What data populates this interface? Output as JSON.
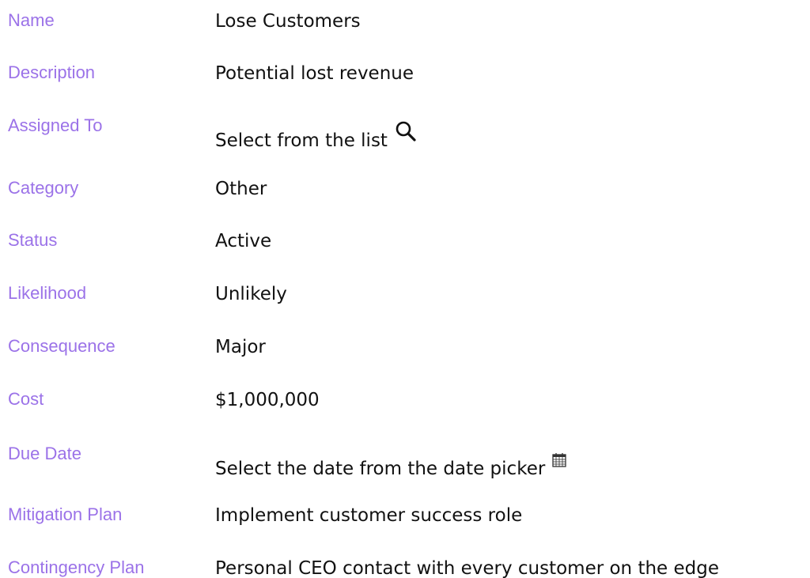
{
  "fields": [
    {
      "label": "Name",
      "value": "Lose Customers"
    },
    {
      "label": "Description",
      "value": "Potential lost revenue"
    },
    {
      "label": "Assigned To",
      "value": "Select from the list",
      "icon": "search-icon"
    },
    {
      "label": "Category",
      "value": "Other"
    },
    {
      "label": "Status",
      "value": "Active"
    },
    {
      "label": "Likelihood",
      "value": "Unlikely"
    },
    {
      "label": "Consequence",
      "value": "Major"
    },
    {
      "label": "Cost",
      "value": "$1,000,000"
    },
    {
      "label": "Due Date",
      "value": "Select the date from the date picker",
      "icon": "calendar-icon"
    },
    {
      "label": "Mitigation Plan",
      "value": "Implement customer success role"
    },
    {
      "label": "Contingency Plan",
      "value": "Personal CEO contact with every customer on the edge"
    }
  ],
  "colors": {
    "label": "#9b72e8",
    "value": "#111111",
    "background": "#ffffff"
  }
}
